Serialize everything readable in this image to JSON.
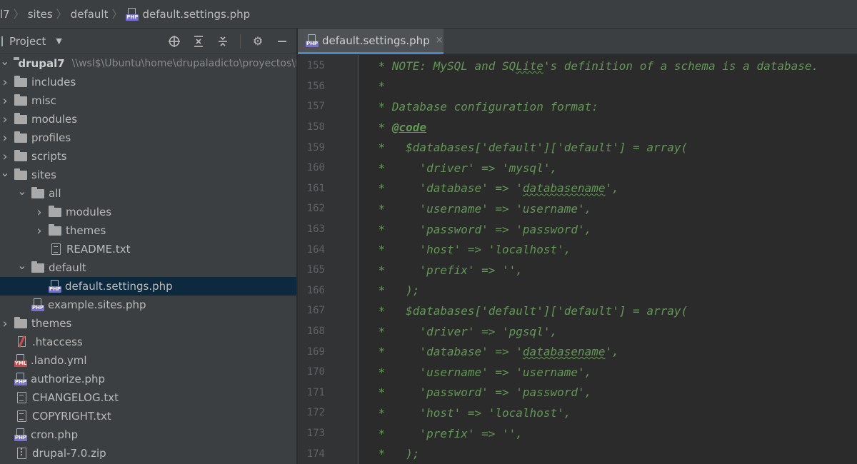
{
  "breadcrumb": [
    "l7",
    "sites",
    "default",
    "default.settings.php"
  ],
  "panel": {
    "title": "Project",
    "tools": [
      "locate-icon",
      "expand-all-icon",
      "collapse-all-icon",
      "gear-icon",
      "minimize-icon"
    ]
  },
  "tree": [
    {
      "label": "drupal7",
      "path": "\\\\wsl$\\Ubuntu\\home\\drupaladicto\\proyectos\\fo",
      "type": "folder",
      "depth": 0,
      "expanded": true,
      "bold": true
    },
    {
      "label": "includes",
      "type": "folder",
      "depth": 0,
      "expanded": false
    },
    {
      "label": "misc",
      "type": "folder",
      "depth": 0,
      "expanded": false
    },
    {
      "label": "modules",
      "type": "folder",
      "depth": 0,
      "expanded": false
    },
    {
      "label": "profiles",
      "type": "folder",
      "depth": 0,
      "expanded": false
    },
    {
      "label": "scripts",
      "type": "folder",
      "depth": 0,
      "expanded": false
    },
    {
      "label": "sites",
      "type": "folder",
      "depth": 0,
      "expanded": true
    },
    {
      "label": "all",
      "type": "folder",
      "depth": 1,
      "expanded": true
    },
    {
      "label": "modules",
      "type": "folder",
      "depth": 2,
      "expanded": false
    },
    {
      "label": "themes",
      "type": "folder",
      "depth": 2,
      "expanded": false
    },
    {
      "label": "README.txt",
      "type": "txt",
      "depth": 2
    },
    {
      "label": "default",
      "type": "folder",
      "depth": 1,
      "expanded": true
    },
    {
      "label": "default.settings.php",
      "type": "php",
      "depth": 2,
      "selected": true
    },
    {
      "label": "example.sites.php",
      "type": "php",
      "depth": 1
    },
    {
      "label": "themes",
      "type": "folder",
      "depth": 0,
      "expanded": false
    },
    {
      "label": ".htaccess",
      "type": "htaccess",
      "depth": 0
    },
    {
      "label": ".lando.yml",
      "type": "yml",
      "depth": 0
    },
    {
      "label": "authorize.php",
      "type": "php",
      "depth": 0
    },
    {
      "label": "CHANGELOG.txt",
      "type": "txt",
      "depth": 0
    },
    {
      "label": "COPYRIGHT.txt",
      "type": "txt",
      "depth": 0
    },
    {
      "label": "cron.php",
      "type": "php",
      "depth": 0
    },
    {
      "label": "drupal-7.0.zip",
      "type": "zip",
      "depth": 0
    }
  ],
  "tab": {
    "label": "default.settings.php",
    "close": "×"
  },
  "colors": {
    "comment": "#629755",
    "selection": "#0d293e",
    "tab_underline": "#4a88c7"
  },
  "code_lines": [
    {
      "num": "155",
      "text": " * NOTE: MySQL and SQLite's definition of a schema is a database."
    },
    {
      "num": "156",
      "text": " *"
    },
    {
      "num": "157",
      "text": " * Database configuration format:"
    },
    {
      "num": "158",
      "text": " * @code"
    },
    {
      "num": "159",
      "text": " *   $databases['default']['default'] = array("
    },
    {
      "num": "160",
      "text": " *     'driver' => 'mysql',"
    },
    {
      "num": "161",
      "text": " *     'database' => 'databasename',"
    },
    {
      "num": "162",
      "text": " *     'username' => 'username',"
    },
    {
      "num": "163",
      "text": " *     'password' => 'password',"
    },
    {
      "num": "164",
      "text": " *     'host' => 'localhost',"
    },
    {
      "num": "165",
      "text": " *     'prefix' => '',"
    },
    {
      "num": "166",
      "text": " *   );"
    },
    {
      "num": "167",
      "text": " *   $databases['default']['default'] = array("
    },
    {
      "num": "168",
      "text": " *     'driver' => 'pgsql',"
    },
    {
      "num": "169",
      "text": " *     'database' => 'databasename',"
    },
    {
      "num": "170",
      "text": " *     'username' => 'username',"
    },
    {
      "num": "171",
      "text": " *     'password' => 'password',"
    },
    {
      "num": "172",
      "text": " *     'host' => 'localhost',"
    },
    {
      "num": "173",
      "text": " *     'prefix' => '',"
    },
    {
      "num": "174",
      "text": " *   );"
    }
  ]
}
